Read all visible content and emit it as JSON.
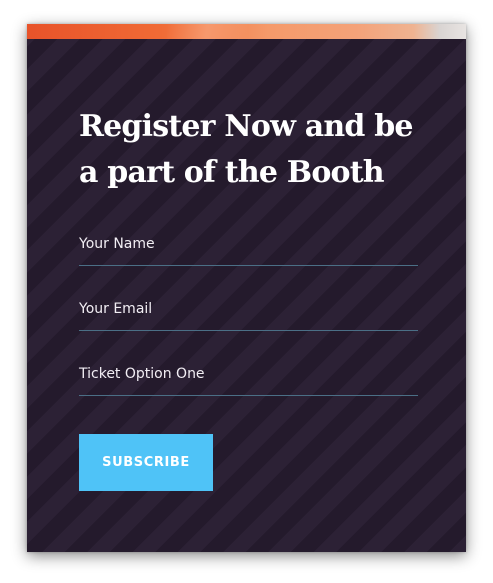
{
  "form": {
    "title": "Register Now and be a part of the Booth",
    "fields": [
      {
        "label": "Your Name"
      },
      {
        "label": "Your Email"
      },
      {
        "label": "Ticket Option One"
      }
    ],
    "submit_label": "SUBSCRIBE"
  },
  "colors": {
    "background": "#2a1f33",
    "accent_strip": "#f06a35",
    "button": "#4fc3f7",
    "field_underline": "#4b6f86",
    "text": "#ffffff"
  }
}
